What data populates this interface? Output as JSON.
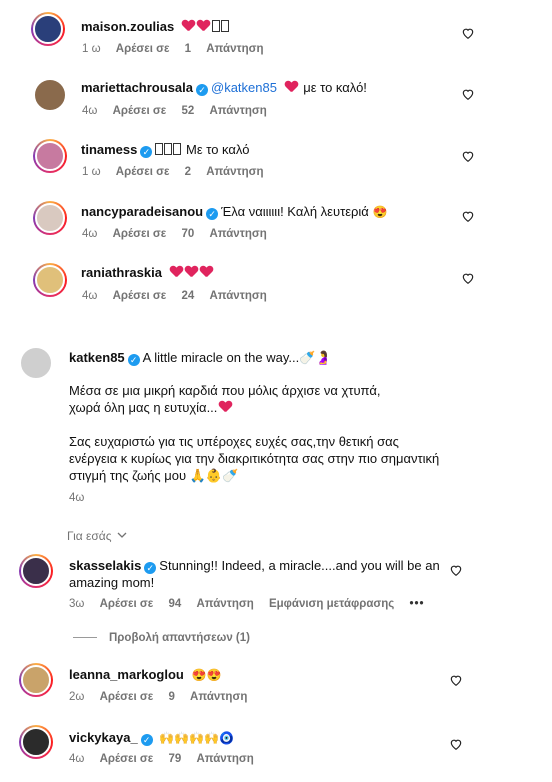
{
  "meta_labels": {
    "like": "Αρέσει σε",
    "reply": "Απάντηση"
  },
  "comments_top": [
    {
      "user": "maison.zoulias",
      "text": "",
      "age": "1 ω",
      "likes": "1",
      "avatar_color": "#2a3f7a"
    },
    {
      "user": "mariettachrousala",
      "mention": "@katken85",
      "text": "με το καλό!",
      "age": "4ω",
      "likes": "52",
      "avatar_color": "#8a6a4c"
    },
    {
      "user": "tinamess",
      "text": "Με το καλό",
      "age": "1 ω",
      "likes": "2",
      "avatar_color": "#c77aa0"
    },
    {
      "user": "nancyparadeisanou",
      "text": "Έλα ναιιιιιι! Καλή λευτεριά",
      "age": "4ω",
      "likes": "70",
      "avatar_color": "#d9c9c0"
    },
    {
      "user": "raniathraskia",
      "text": "",
      "age": "4ω",
      "likes": "24",
      "avatar_color": "#e0c07a"
    }
  ],
  "post": {
    "user": "katken85",
    "caption": "A little miracle on the way...",
    "p1": "Μέσα σε μια μικρή καρδιά που μόλις άρχισε να χτυπά,\nχωρά όλη μας η ευτυχία...",
    "p2": "Σας ευχαριστώ για τις υπέροχες ευχές σας,την θετική σας\nενέργεια κ κυρίως για την διακριτικότητα σας στην πιο σημαντική\nστιγμή της ζωής μου",
    "age": "4ω",
    "avatar_color": "#cfcfcf"
  },
  "for_you": "Για εσάς",
  "comments_bottom": [
    {
      "user": "skasselakis",
      "text1": "Stunning!! Indeed, a miracle....and you will be an",
      "text2": "amazing mom!",
      "age": "3ω",
      "likes": "94",
      "translate": "Εμφάνιση μετάφρασης",
      "avatar_color": "#3a2f4a"
    },
    {
      "user": "leanna_markoglou",
      "text": "",
      "age": "2ω",
      "likes": "9",
      "avatar_color": "#c9a36a"
    },
    {
      "user": "vickykaya_",
      "text": "",
      "age": "4ω",
      "likes": "79",
      "avatar_color": "#2b2b2b"
    }
  ],
  "view_replies": "Προβολή απαντήσεων (1)",
  "colors": {
    "verified": "#1d9bf0",
    "heart": "#e0245e",
    "muted": "#737373",
    "mention": "#1d6fd6"
  },
  "icons": [
    "heart-outline-icon",
    "verified-badge-icon",
    "chevron-down-icon",
    "more-icon"
  ]
}
